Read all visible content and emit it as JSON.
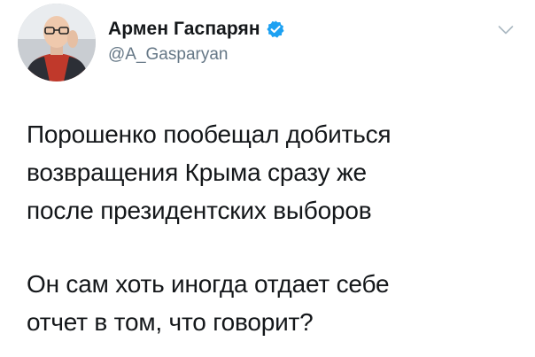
{
  "tweet": {
    "author": {
      "display_name": "Армен Гаспарян",
      "handle": "@A_Gasparyan",
      "verified": true,
      "avatar_icon": "user-photo"
    },
    "menu_icon": "chevron-down-icon",
    "paragraphs": [
      {
        "lines": [
          "Порошенко пообещал добиться",
          "возвращения Крыма сразу же",
          "после президентских выборов"
        ]
      },
      {
        "lines": [
          "Он сам хоть иногда отдает себе",
          "отчет в том, что говорит?"
        ]
      }
    ]
  },
  "colors": {
    "text": "#14171a",
    "secondary": "#657786",
    "verified_blue": "#1da1f2"
  }
}
